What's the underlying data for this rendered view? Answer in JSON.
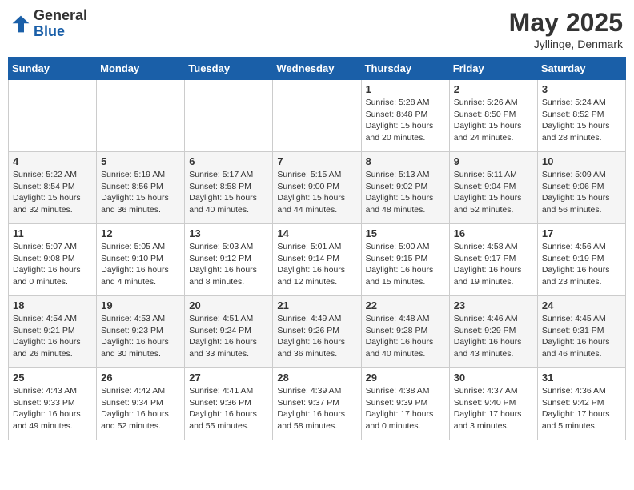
{
  "header": {
    "logo_general": "General",
    "logo_blue": "Blue",
    "month_title": "May 2025",
    "location": "Jyllinge, Denmark"
  },
  "weekdays": [
    "Sunday",
    "Monday",
    "Tuesday",
    "Wednesday",
    "Thursday",
    "Friday",
    "Saturday"
  ],
  "weeks": [
    [
      {
        "day": "",
        "info": ""
      },
      {
        "day": "",
        "info": ""
      },
      {
        "day": "",
        "info": ""
      },
      {
        "day": "",
        "info": ""
      },
      {
        "day": "1",
        "info": "Sunrise: 5:28 AM\nSunset: 8:48 PM\nDaylight: 15 hours\nand 20 minutes."
      },
      {
        "day": "2",
        "info": "Sunrise: 5:26 AM\nSunset: 8:50 PM\nDaylight: 15 hours\nand 24 minutes."
      },
      {
        "day": "3",
        "info": "Sunrise: 5:24 AM\nSunset: 8:52 PM\nDaylight: 15 hours\nand 28 minutes."
      }
    ],
    [
      {
        "day": "4",
        "info": "Sunrise: 5:22 AM\nSunset: 8:54 PM\nDaylight: 15 hours\nand 32 minutes."
      },
      {
        "day": "5",
        "info": "Sunrise: 5:19 AM\nSunset: 8:56 PM\nDaylight: 15 hours\nand 36 minutes."
      },
      {
        "day": "6",
        "info": "Sunrise: 5:17 AM\nSunset: 8:58 PM\nDaylight: 15 hours\nand 40 minutes."
      },
      {
        "day": "7",
        "info": "Sunrise: 5:15 AM\nSunset: 9:00 PM\nDaylight: 15 hours\nand 44 minutes."
      },
      {
        "day": "8",
        "info": "Sunrise: 5:13 AM\nSunset: 9:02 PM\nDaylight: 15 hours\nand 48 minutes."
      },
      {
        "day": "9",
        "info": "Sunrise: 5:11 AM\nSunset: 9:04 PM\nDaylight: 15 hours\nand 52 minutes."
      },
      {
        "day": "10",
        "info": "Sunrise: 5:09 AM\nSunset: 9:06 PM\nDaylight: 15 hours\nand 56 minutes."
      }
    ],
    [
      {
        "day": "11",
        "info": "Sunrise: 5:07 AM\nSunset: 9:08 PM\nDaylight: 16 hours\nand 0 minutes."
      },
      {
        "day": "12",
        "info": "Sunrise: 5:05 AM\nSunset: 9:10 PM\nDaylight: 16 hours\nand 4 minutes."
      },
      {
        "day": "13",
        "info": "Sunrise: 5:03 AM\nSunset: 9:12 PM\nDaylight: 16 hours\nand 8 minutes."
      },
      {
        "day": "14",
        "info": "Sunrise: 5:01 AM\nSunset: 9:14 PM\nDaylight: 16 hours\nand 12 minutes."
      },
      {
        "day": "15",
        "info": "Sunrise: 5:00 AM\nSunset: 9:15 PM\nDaylight: 16 hours\nand 15 minutes."
      },
      {
        "day": "16",
        "info": "Sunrise: 4:58 AM\nSunset: 9:17 PM\nDaylight: 16 hours\nand 19 minutes."
      },
      {
        "day": "17",
        "info": "Sunrise: 4:56 AM\nSunset: 9:19 PM\nDaylight: 16 hours\nand 23 minutes."
      }
    ],
    [
      {
        "day": "18",
        "info": "Sunrise: 4:54 AM\nSunset: 9:21 PM\nDaylight: 16 hours\nand 26 minutes."
      },
      {
        "day": "19",
        "info": "Sunrise: 4:53 AM\nSunset: 9:23 PM\nDaylight: 16 hours\nand 30 minutes."
      },
      {
        "day": "20",
        "info": "Sunrise: 4:51 AM\nSunset: 9:24 PM\nDaylight: 16 hours\nand 33 minutes."
      },
      {
        "day": "21",
        "info": "Sunrise: 4:49 AM\nSunset: 9:26 PM\nDaylight: 16 hours\nand 36 minutes."
      },
      {
        "day": "22",
        "info": "Sunrise: 4:48 AM\nSunset: 9:28 PM\nDaylight: 16 hours\nand 40 minutes."
      },
      {
        "day": "23",
        "info": "Sunrise: 4:46 AM\nSunset: 9:29 PM\nDaylight: 16 hours\nand 43 minutes."
      },
      {
        "day": "24",
        "info": "Sunrise: 4:45 AM\nSunset: 9:31 PM\nDaylight: 16 hours\nand 46 minutes."
      }
    ],
    [
      {
        "day": "25",
        "info": "Sunrise: 4:43 AM\nSunset: 9:33 PM\nDaylight: 16 hours\nand 49 minutes."
      },
      {
        "day": "26",
        "info": "Sunrise: 4:42 AM\nSunset: 9:34 PM\nDaylight: 16 hours\nand 52 minutes."
      },
      {
        "day": "27",
        "info": "Sunrise: 4:41 AM\nSunset: 9:36 PM\nDaylight: 16 hours\nand 55 minutes."
      },
      {
        "day": "28",
        "info": "Sunrise: 4:39 AM\nSunset: 9:37 PM\nDaylight: 16 hours\nand 58 minutes."
      },
      {
        "day": "29",
        "info": "Sunrise: 4:38 AM\nSunset: 9:39 PM\nDaylight: 17 hours\nand 0 minutes."
      },
      {
        "day": "30",
        "info": "Sunrise: 4:37 AM\nSunset: 9:40 PM\nDaylight: 17 hours\nand 3 minutes."
      },
      {
        "day": "31",
        "info": "Sunrise: 4:36 AM\nSunset: 9:42 PM\nDaylight: 17 hours\nand 5 minutes."
      }
    ]
  ]
}
